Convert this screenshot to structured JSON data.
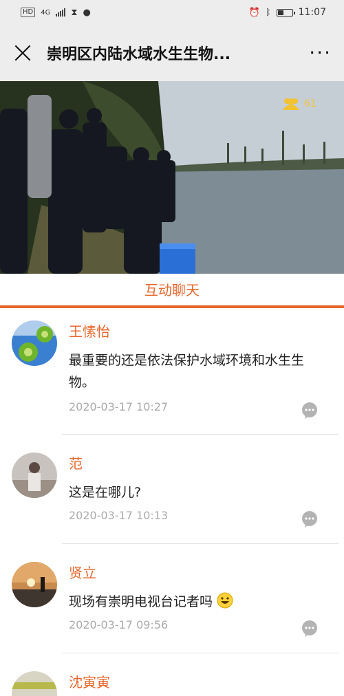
{
  "status_bar": {
    "network_badge": "HD",
    "network_type": "4G",
    "time": "11:07"
  },
  "header": {
    "title": "崇明区内陆水域水生生物..."
  },
  "video": {
    "viewer_count": "61"
  },
  "tabs": [
    {
      "label": "互动聊天"
    }
  ],
  "comments": [
    {
      "name": "王愫怡",
      "text": "最重要的还是依法保护水域环境和水生生物。",
      "time": "2020-03-17 10:27"
    },
    {
      "name": "范",
      "text": "这是在哪儿?",
      "time": "2020-03-17 10:13"
    },
    {
      "name": "贤立",
      "text": "现场有崇明电视台记者吗",
      "time": "2020-03-17 09:56"
    },
    {
      "name": "沈寅寅",
      "text": "",
      "time": ""
    }
  ],
  "icons": [
    "close-icon",
    "more-icon",
    "viewers-icon",
    "reply-icon",
    "smile-emoji-icon"
  ],
  "colors": {
    "accent": "#e8672c",
    "viewers": "#f2c230"
  }
}
